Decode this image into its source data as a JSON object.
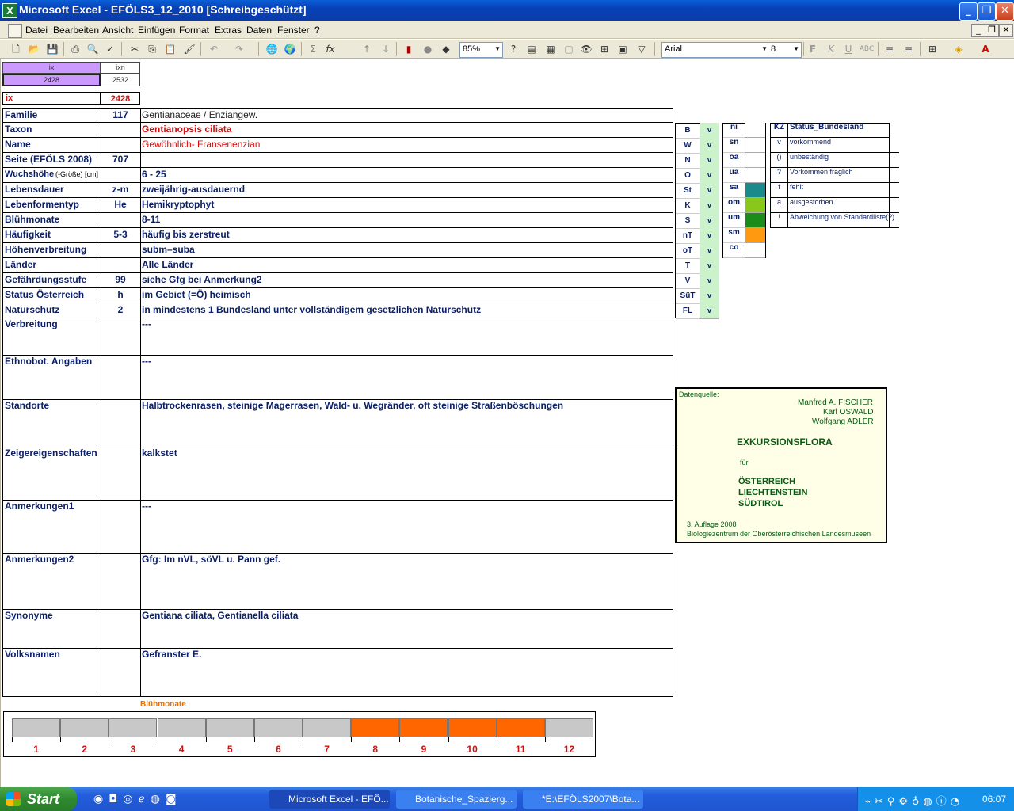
{
  "window": {
    "title": "Microsoft Excel - EFÖLS3_12_2010  [Schreibgeschützt]"
  },
  "menu": [
    "Datei",
    "Bearbeiten",
    "Ansicht",
    "Einfügen",
    "Format",
    "Extras",
    "Daten",
    "Fenster",
    "?"
  ],
  "toolbar": {
    "zoom": "85%",
    "font": "Arial",
    "font_size": "8"
  },
  "index": {
    "ix_label": "ix",
    "ixn_label": "ixn",
    "ix_value": "2428",
    "ixn_value": "2532",
    "ix_big_label": "ix",
    "ix_big_value": "2428"
  },
  "rows": [
    {
      "label": "Familie",
      "code": "117",
      "value": "Gentianaceae  /  Enziangew."
    },
    {
      "label": "Taxon",
      "code": "",
      "value": "Gentianopsis ciliata"
    },
    {
      "label": "Name",
      "code": "",
      "value": "Gewöhnlich- Fransenenzian"
    },
    {
      "label": "Seite (EFÖLS 2008)",
      "code": "707",
      "value": ""
    },
    {
      "label": "Wuchshöhe",
      "label_suffix": "(-Größe) [cm]",
      "code": "",
      "value": "6 - 25"
    },
    {
      "label": "Lebensdauer",
      "code": "z-m",
      "value": "zweijährig-ausdauernd"
    },
    {
      "label": "Lebenformentyp",
      "code": "He",
      "value": "Hemikryptophyt"
    },
    {
      "label": "Blühmonate",
      "code": "",
      "value": "8-11"
    },
    {
      "label": "Häufigkeit",
      "code": "5-3",
      "value": "häufig bis zerstreut"
    },
    {
      "label": "Höhenverbreitung",
      "code": "",
      "value": "subm–suba"
    },
    {
      "label": "Länder",
      "code": "",
      "value": "Alle Länder"
    },
    {
      "label": "Gefährdungsstufe",
      "code": "99",
      "value": "siehe Gfg bei Anmerkung2"
    },
    {
      "label": "Status Österreich",
      "code": "h",
      "value": "im Gebiet (=Ö) heimisch"
    },
    {
      "label": "Naturschutz",
      "code": "2",
      "value": "in mindestens 1 Bundesland unter vollständigem gesetzlichen Naturschutz"
    },
    {
      "label": "Verbreitung",
      "code": "",
      "value": "---"
    },
    {
      "label": "Ethnobot. Angaben",
      "code": "",
      "value": "---"
    },
    {
      "label": "Standorte",
      "code": "",
      "value": "Halbtrockenrasen, steinige Magerrasen, Wald- u. Wegränder, oft steinige Straßenböschungen"
    },
    {
      "label": "Zeigereigenschaften",
      "code": "",
      "value": "kalkstet"
    },
    {
      "label": "Anmerkungen1",
      "code": "",
      "value": "---"
    },
    {
      "label": "Anmerkungen2",
      "code": "",
      "value": "Gfg: Im nVL, söVL u. Pann gef."
    },
    {
      "label": "Synonyme",
      "code": "",
      "value": "Gentiana ciliata, Gentianella ciliata"
    },
    {
      "label": "Volksnamen",
      "code": "",
      "value": "Gefranster E."
    }
  ],
  "bundeslaender": [
    {
      "code": "B",
      "status": "v"
    },
    {
      "code": "W",
      "status": "v"
    },
    {
      "code": "N",
      "status": "v"
    },
    {
      "code": "O",
      "status": "v"
    },
    {
      "code": "St",
      "status": "v"
    },
    {
      "code": "K",
      "status": "v"
    },
    {
      "code": "S",
      "status": "v"
    },
    {
      "code": "nT",
      "status": "v"
    },
    {
      "code": "oT",
      "status": "v"
    },
    {
      "code": "T",
      "status": "v"
    },
    {
      "code": "V",
      "status": "v"
    },
    {
      "code": "SüT",
      "status": "v"
    },
    {
      "code": "FL",
      "status": "v"
    }
  ],
  "hoehenstufen": [
    {
      "code": "ni",
      "color": ""
    },
    {
      "code": "sn",
      "color": ""
    },
    {
      "code": "oa",
      "color": ""
    },
    {
      "code": "ua",
      "color": ""
    },
    {
      "code": "sa",
      "color": "#1a8a8a"
    },
    {
      "code": "om",
      "color": "#88c81a"
    },
    {
      "code": "um",
      "color": "#1a8c1a"
    },
    {
      "code": "sm",
      "color": "#ff9a10"
    },
    {
      "code": "co",
      "color": ""
    }
  ],
  "legend": {
    "header_kz": "KZ",
    "header_status": "Status_Bundesland",
    "items": [
      {
        "kz": "v",
        "text": "vorkommend"
      },
      {
        "kz": "()",
        "text": "unbeständig"
      },
      {
        "kz": "?",
        "text": "Vorkommen fraglich"
      },
      {
        "kz": "f",
        "text": "fehlt"
      },
      {
        "kz": "a",
        "text": "ausgestorben"
      },
      {
        "kz": "!",
        "text": "Abweichung von Standardliste(?)"
      }
    ]
  },
  "datasource": {
    "label": "Datenquelle:",
    "author1": "Manfred A. FISCHER",
    "author2": "Karl OSWALD",
    "author3": "Wolfgang ADLER",
    "title": "EXKURSIONSFLORA",
    "fuer": "für",
    "country1": "ÖSTERREICH",
    "country2": "LIECHTENSTEIN",
    "country3": "SÜDTIROL",
    "edition": "3. Auflage 2008",
    "publisher": "Biologiezentrum der Oberösterreichischen Landesmuseen"
  },
  "bluehmonate": {
    "title": "Blühmonate",
    "months": [
      "1",
      "2",
      "3",
      "4",
      "5",
      "6",
      "7",
      "8",
      "9",
      "10",
      "11",
      "12"
    ],
    "active": [
      8,
      9,
      10,
      11
    ],
    "active_color": "#ff6600",
    "inactive_color": "#c8c8c8"
  },
  "taskbar": {
    "start": "Start",
    "tasks": [
      "Microsoft Excel - EFÖ...",
      "Botanische_Spazierg...",
      "*E:\\EFÖLS2007\\Bota..."
    ],
    "clock": "06:07"
  }
}
